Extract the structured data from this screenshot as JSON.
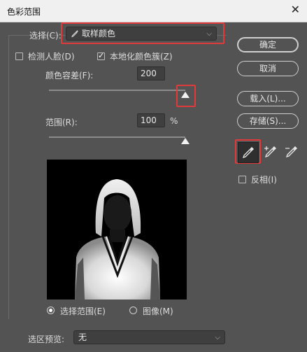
{
  "window": {
    "title": "色彩范围",
    "close_glyph": "✕"
  },
  "select": {
    "label": "选择(C):",
    "value": "取样颜色",
    "icon": "eyedropper-icon"
  },
  "checkboxes": {
    "detect_faces": {
      "label": "检测人脸(D)",
      "checked": false
    },
    "localized": {
      "label": "本地化颜色簇(Z)",
      "checked": true
    }
  },
  "fuzziness": {
    "label": "颜色容差(F):",
    "value": "200",
    "slider_fraction": 1.0
  },
  "range": {
    "label": "范围(R):",
    "value": "100",
    "unit": "%",
    "slider_fraction": 1.0
  },
  "buttons": {
    "ok": "确定",
    "cancel": "取消",
    "load": "载入(L)...",
    "save": "存储(S)..."
  },
  "tools": [
    "eyedropper-icon",
    "eyedropper-plus-icon",
    "eyedropper-minus-icon"
  ],
  "invert": {
    "label": "反相(I)",
    "checked": false
  },
  "preview_mode": {
    "selection": "选择范围(E)",
    "image": "图像(M)",
    "selected": "selection"
  },
  "selection_preview": {
    "label": "选区预览:",
    "value": "无"
  },
  "colors": {
    "highlight": "#e03a3a",
    "panel": "#535353"
  }
}
